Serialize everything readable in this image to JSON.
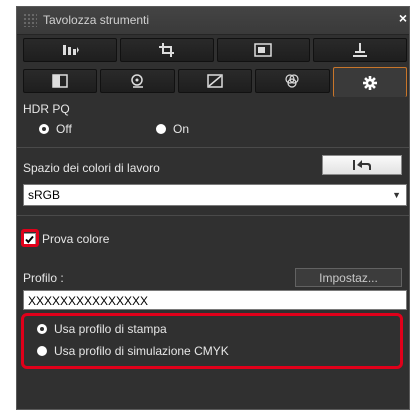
{
  "window": {
    "title": "Tavolozza strumenti",
    "close_glyph": "×"
  },
  "toolbar_row1": [
    {
      "icon": "tone-curve-icon"
    },
    {
      "icon": "crop-icon"
    },
    {
      "icon": "image-icon"
    },
    {
      "icon": "stamp-icon"
    }
  ],
  "toolbar_row2": [
    {
      "icon": "brightness-icon"
    },
    {
      "icon": "zoom-icon"
    },
    {
      "icon": "curve-icon"
    },
    {
      "icon": "color-icon"
    },
    {
      "icon": "gear-icon",
      "active": true
    }
  ],
  "hdr": {
    "label": "HDR PQ",
    "off_label": "Off",
    "on_label": "On",
    "selected": "Off"
  },
  "color_space": {
    "label": "Spazio dei colori di lavoro",
    "undo_icon": "reset-arrow-icon",
    "value": "sRGB"
  },
  "proof": {
    "checkbox_label": "Prova colore",
    "checked": true,
    "profile_label": "Profilo :",
    "settings_button": "Impostaz...",
    "profile_value": "XXXXXXXXXXXXXXX",
    "options": [
      {
        "label": "Usa profilo di stampa",
        "selected": true
      },
      {
        "label": "Usa profilo di simulazione CMYK",
        "selected": false
      }
    ]
  },
  "colors": {
    "panel_bg": "#303030",
    "accent_tab": "#c9762a",
    "highlight": "#e0001a"
  }
}
